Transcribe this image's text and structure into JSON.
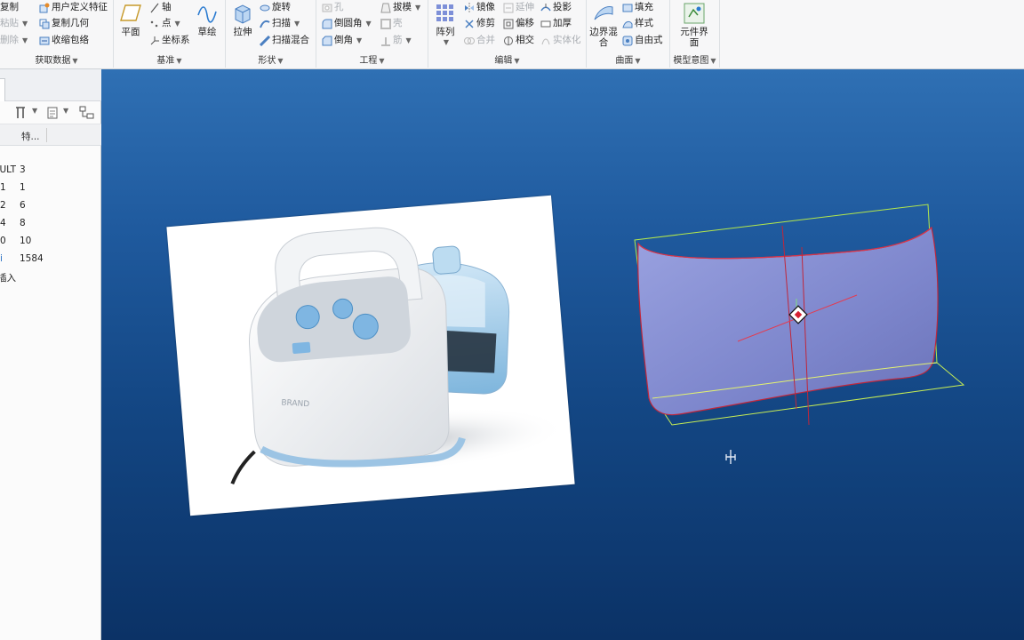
{
  "ribbon": {
    "groups": [
      {
        "label": "获取数据"
      },
      {
        "label": "基准"
      },
      {
        "label": "形状"
      },
      {
        "label": "工程"
      },
      {
        "label": "编辑"
      },
      {
        "label": "曲面"
      },
      {
        "label": "模型意图"
      }
    ],
    "get_data": {
      "copy": "复制",
      "paste": "粘贴",
      "delete": "删除",
      "user_defined_feature": "用户定义特征",
      "copy_geometry": "复制几何",
      "shrinkwrap": "收缩包络"
    },
    "datum": {
      "plane": "平面",
      "axis": "轴",
      "point": "点",
      "coordinate_system": "坐标系",
      "sketch": "草绘"
    },
    "shapes": {
      "extrude": "拉伸",
      "revolve": "旋转",
      "sweep": "扫描",
      "swept_blend": "扫描混合"
    },
    "engineering": {
      "hole": "孔",
      "round": "倒圆角",
      "chamfer": "倒角",
      "draft": "拔模",
      "shell": "壳",
      "rib": "筋"
    },
    "editing": {
      "pattern": "阵列",
      "mirror": "镜像",
      "trim": "修剪",
      "merge": "合并",
      "extend": "延伸",
      "offset": "偏移",
      "intersect": "相交",
      "project": "投影",
      "thicken": "加厚",
      "solidify": "实体化"
    },
    "surfaces": {
      "boundary_blend": "边界混合",
      "fill": "填充",
      "style": "样式",
      "freestyle": "自由式"
    },
    "model_intent": {
      "component_interface": "元件界面"
    }
  },
  "left_panel": {
    "column_header": "特...",
    "rows": [
      {
        "name": "DEFAULT",
        "value": "3"
      },
      {
        "name": "1",
        "value": "1"
      },
      {
        "name": "2",
        "value": "6"
      },
      {
        "name": "4",
        "value": "8"
      },
      {
        "name": "0",
        "value": "10"
      },
      {
        "name": "i",
        "value": "1584"
      },
      {
        "name": "插入",
        "value": ""
      }
    ]
  },
  "viewport": {
    "photo_brand": "BRAND",
    "colors": {
      "bg_top": "#2f70b4",
      "bg_bottom": "#0b3266",
      "surface": "#8a93d4",
      "datum_plane": "#b5e84a",
      "edges": "#c0263a"
    }
  }
}
